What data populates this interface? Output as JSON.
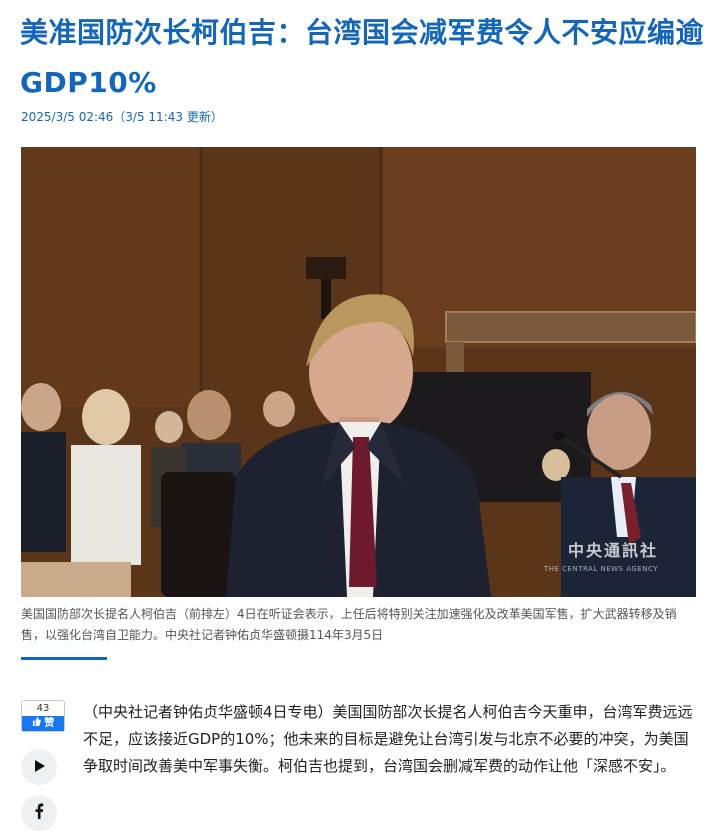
{
  "article": {
    "title": "美准国防次长柯伯吉：台湾国会减军费令人不安应编逾GDP10%",
    "dateline": "2025/3/5 02:46（3/5 11:43 更新）",
    "photo": {
      "watermark": "中央通訊社",
      "watermark_en": "THE CENTRAL NEWS AGENCY"
    },
    "caption": "美国国防部次长提名人柯伯吉（前排左）4日在听证会表示，上任后将特别关注加速强化及改革美国军售，扩大武器转移及销售，以强化台湾自卫能力。中央社记者钟佑贞华盛顿摄114年3月5日",
    "body": "（中央社记者钟佑贞华盛顿4日专电）美国国防部次长提名人柯伯吉今天重申，台湾军费远远不足，应该接近GDP的10%；他未来的目标是避免让台湾引发与北京不必要的冲突，为美国争取时间改善美中军事失衡。柯伯吉也提到，台湾国会删减军费的动作让他「深感不安」。"
  },
  "share": {
    "like_count": "43",
    "like_label": "赞",
    "like_icon": "thumbs-up-icon",
    "play_icon": "play-icon",
    "facebook_icon": "facebook-icon"
  },
  "colors": {
    "accent": "#1466b8",
    "facebook": "#1877f2"
  }
}
